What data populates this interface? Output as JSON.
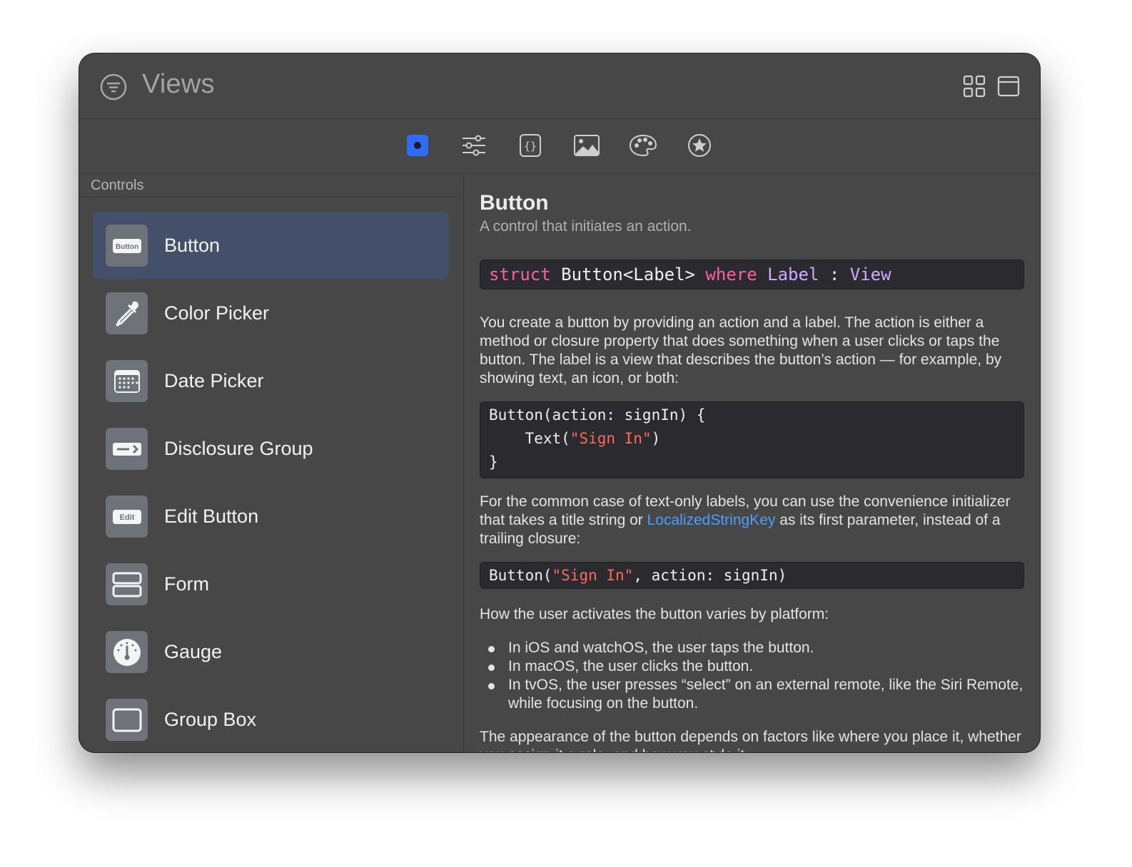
{
  "window": {
    "title": "Views"
  },
  "toolbar": {
    "tabs": [
      {
        "icon": "views-icon",
        "active": true
      },
      {
        "icon": "modifiers-icon"
      },
      {
        "icon": "snippets-icon"
      },
      {
        "icon": "media-icon"
      },
      {
        "icon": "colors-icon"
      },
      {
        "icon": "favorites-icon"
      }
    ]
  },
  "sidebar": {
    "section": "Controls",
    "items": [
      {
        "label": "Button",
        "icon": "button-icon",
        "icon_text": "Button"
      },
      {
        "label": "Color Picker",
        "icon": "eyedropper-icon"
      },
      {
        "label": "Date Picker",
        "icon": "calendar-icon"
      },
      {
        "label": "Disclosure Group",
        "icon": "disclosure-icon"
      },
      {
        "label": "Edit Button",
        "icon": "edit-button-icon",
        "icon_text": "Edit"
      },
      {
        "label": "Form",
        "icon": "form-icon"
      },
      {
        "label": "Gauge",
        "icon": "gauge-icon"
      },
      {
        "label": "Group Box",
        "icon": "group-box-icon"
      }
    ]
  },
  "detail": {
    "title": "Button",
    "subtitle": "A control that initiates an action.",
    "signature": {
      "kw1": "struct",
      "name": " Button<Label> ",
      "kw2": "where",
      "ty1": " Label",
      "sep": " : ",
      "ty2": "View"
    },
    "para1": "You create a button by providing an action and a label. The action is either a method or closure property that does something when a user clicks or taps the button. The label is a view that describes the button’s action — for example, by showing text, an icon, or both:",
    "code1": {
      "line1": "Button(action: signIn) {",
      "line2_pre": "    Text(",
      "line2_str": "\"Sign In\"",
      "line2_post": ")",
      "line3": "}"
    },
    "para2_pre": "For the common case of text-only labels, you can use the convenience initializer that takes a title string or ",
    "para2_link": "LocalizedStringKey",
    "para2_post": " as its first parameter, instead of a trailing closure:",
    "code2": {
      "pre": "Button(",
      "str": "\"Sign In\"",
      "post": ", action: signIn)"
    },
    "para3": "How the user activates the button varies by platform:",
    "bullets": [
      "In iOS and watchOS, the user taps the button.",
      "In macOS, the user clicks the button.",
      "In tvOS, the user presses “select” on an external remote, like the Siri Remote, while focusing on the button."
    ],
    "para4": "The appearance of the button depends on factors like where you place it, whether you assign it a role, and how you style it."
  },
  "colors": {
    "window_bg": "#474747",
    "selected_row": "#44506a",
    "accent": "#2f6cf6",
    "keyword": "#fc5fa3",
    "type": "#d0a8ff",
    "string": "#fc6a5d",
    "link": "#4a9eff"
  }
}
